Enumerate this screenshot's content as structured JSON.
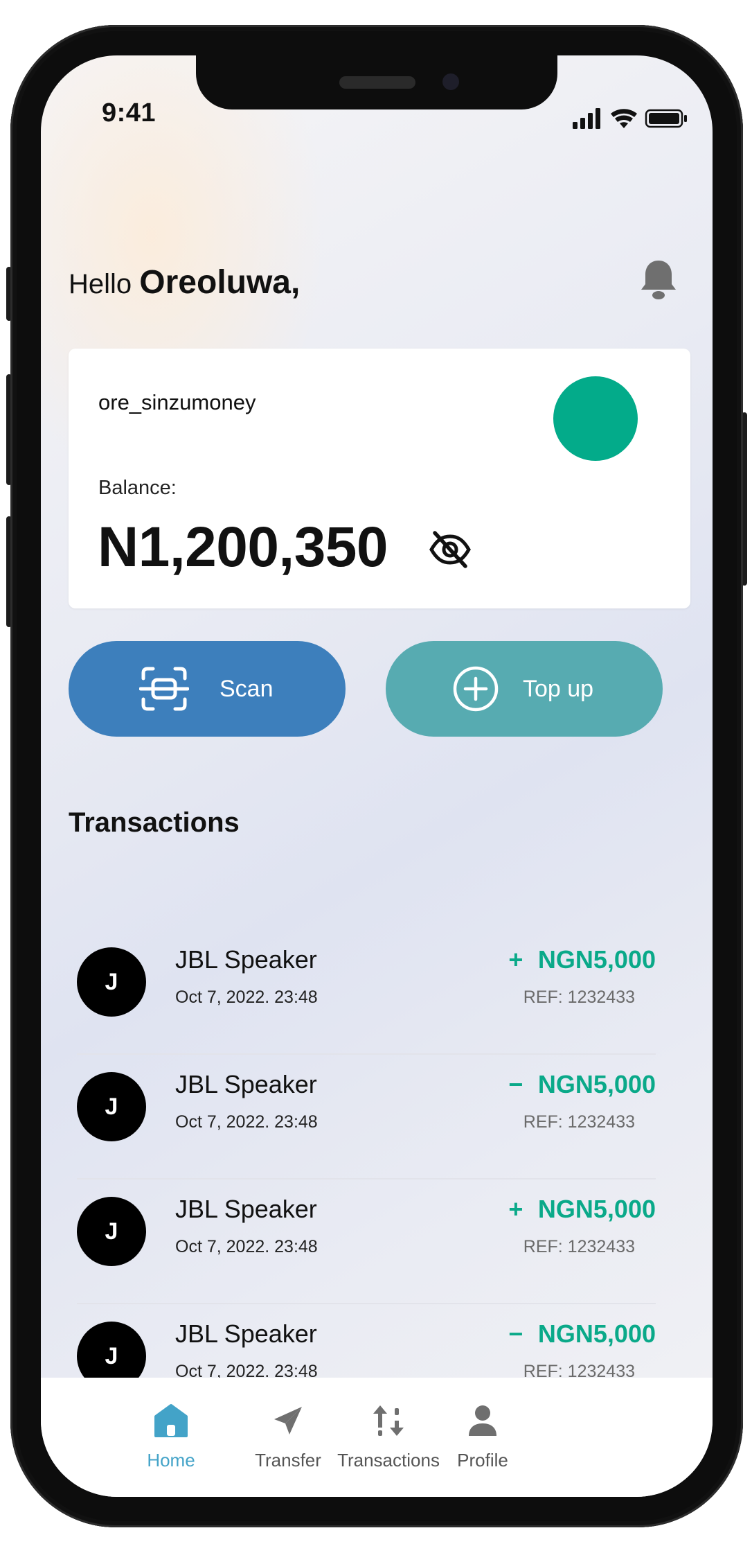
{
  "status_bar": {
    "time": "9:41"
  },
  "greeting": {
    "hello": "Hello",
    "name": "Oreoluwa,"
  },
  "account_card": {
    "username": "ore_sinzumoney",
    "balance_label": "Balance:",
    "balance_value": "N1,200,350",
    "avatar_color": "#03ab8a"
  },
  "actions": {
    "scan_label": "Scan",
    "topup_label": "Top up",
    "scan_color": "#3d7fbc",
    "topup_color": "#57abb1"
  },
  "transactions": {
    "title": "Transactions",
    "items": [
      {
        "initial": "J",
        "title": "JBL Speaker",
        "date": "Oct 7, 2022. 23:48",
        "sign": "+",
        "amount": "NGN5,000",
        "ref": "REF: 1232433"
      },
      {
        "initial": "J",
        "title": "JBL Speaker",
        "date": "Oct 7, 2022. 23:48",
        "sign": "−",
        "amount": "NGN5,000",
        "ref": "REF: 1232433"
      },
      {
        "initial": "J",
        "title": "JBL Speaker",
        "date": "Oct 7, 2022. 23:48",
        "sign": "+",
        "amount": "NGN5,000",
        "ref": "REF: 1232433"
      },
      {
        "initial": "J",
        "title": "JBL Speaker",
        "date": "Oct 7, 2022. 23:48",
        "sign": "−",
        "amount": "NGN5,000",
        "ref": "REF: 1232433"
      }
    ]
  },
  "tab_bar": {
    "active_color": "#43a3c8",
    "tabs": [
      {
        "label": "Home",
        "icon": "home-icon"
      },
      {
        "label": "Transfer",
        "icon": "send-icon"
      },
      {
        "label": "Transactions",
        "icon": "transactions-arrows-icon"
      },
      {
        "label": "Profile",
        "icon": "profile-icon"
      }
    ]
  }
}
